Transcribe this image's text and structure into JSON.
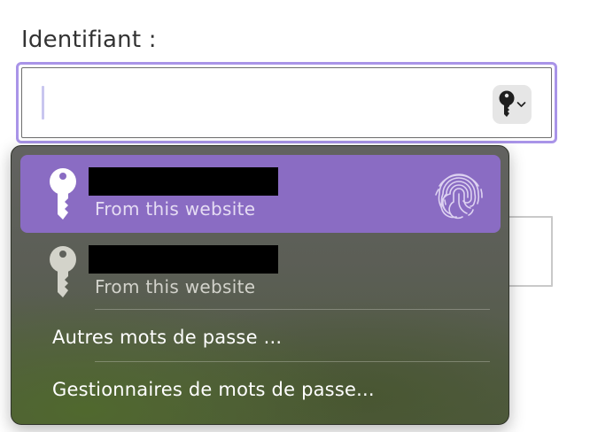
{
  "form": {
    "username_label": "Identifiant :",
    "username_value": ""
  },
  "autofill_button": {
    "icon": "key-icon",
    "chevron": "chevron-down-icon"
  },
  "popup": {
    "suggestions": [
      {
        "username": "████████",
        "source": "From this website",
        "selected": true,
        "icon": "key-icon",
        "auth_icon": "fingerprint-icon"
      },
      {
        "username": "████████",
        "source": "From this website",
        "selected": false,
        "icon": "key-icon"
      }
    ],
    "other_passwords_label": "Autres mots de passe ...",
    "password_managers_label": "Gestionnaires de mots de passe..."
  },
  "colors": {
    "focus_ring": "#a994e8",
    "selection": "#8a6cc3",
    "popup_background": "#5b5e55"
  }
}
